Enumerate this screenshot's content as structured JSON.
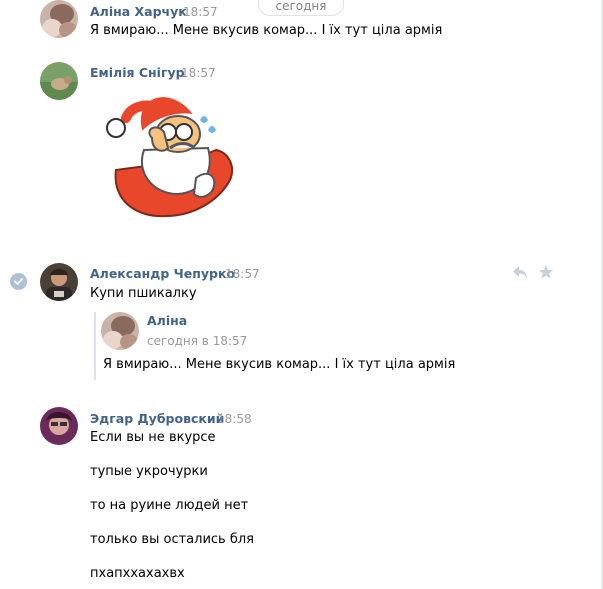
{
  "date_separator": "сегодня",
  "messages": [
    {
      "author": "Аліна Харчук",
      "time": "18:57",
      "lines": [
        "Я вмираю... Мене вкусив комар... І їх тут ціла армія"
      ]
    },
    {
      "author": "Емілія Снігур",
      "time": "18:57",
      "sticker": "santa-facepalm-sticker"
    },
    {
      "author": "Александр Чепурко",
      "time": "18:57",
      "lines": [
        "Купи пшикалку"
      ],
      "quote": {
        "author": "Аліна",
        "time": "сегодня в 18:57",
        "text": "Я вмираю... Мене вкусив комар... І їх тут ціла армія"
      }
    },
    {
      "author": "Эдгар Дубровский",
      "time": "18:58",
      "lines": [
        "Если вы не вкурсе",
        "тупые укрочурки",
        "то на руине людей нет",
        "только вы остались бля",
        "пхапххахахвх"
      ]
    }
  ],
  "colors": {
    "author": "#42648b",
    "time": "#999999",
    "action_icon": "#c5d0db",
    "check": "#aec0d4"
  },
  "icons": {
    "reply": "reply-icon",
    "star": "star-icon",
    "selected": "check-icon"
  }
}
